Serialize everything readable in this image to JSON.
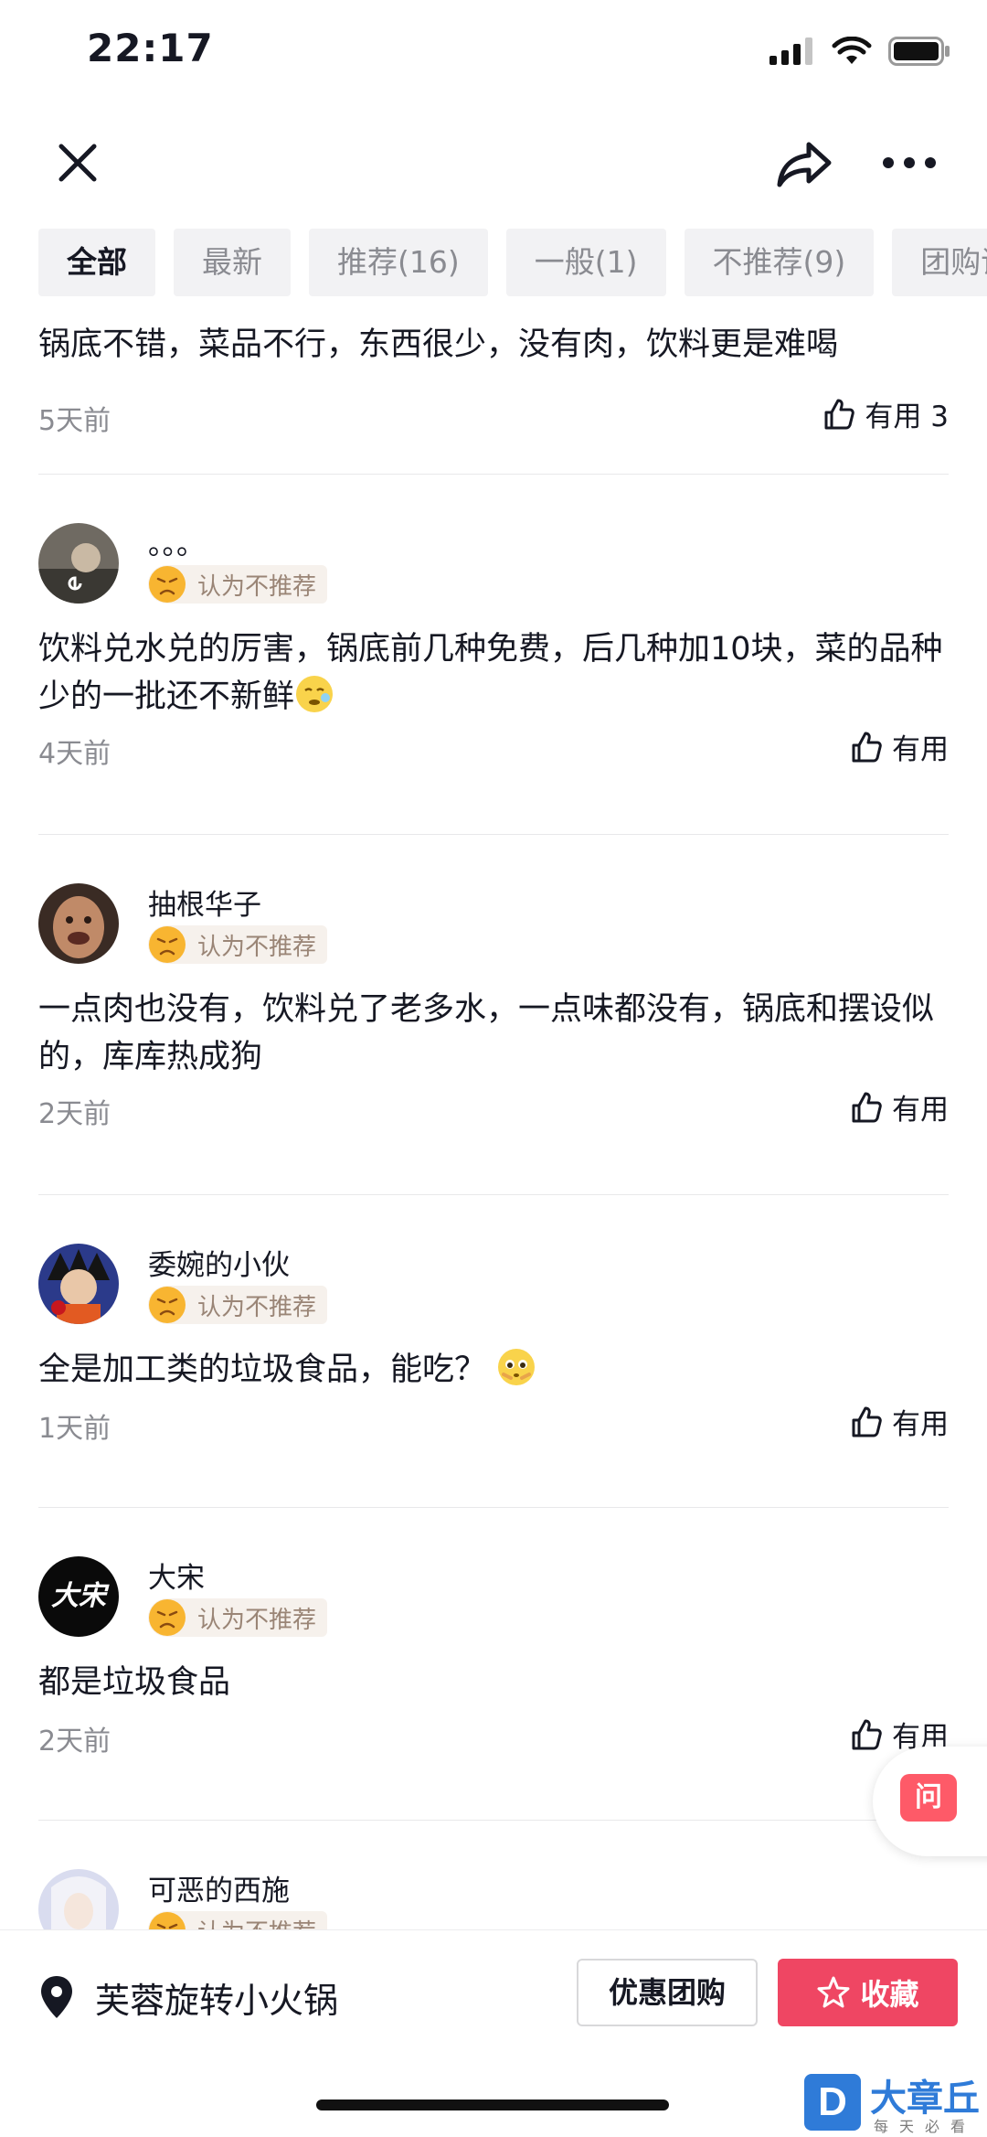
{
  "status_bar": {
    "time": "22:17"
  },
  "filter_tabs": [
    "全部",
    "最新",
    "推荐(16)",
    "一般(1)",
    "不推荐(9)",
    "团购评价"
  ],
  "partial_review": {
    "text": "锅底不错，菜品不行，东西很少，没有肉，饮料更是难喝",
    "time": "5天前",
    "useful_label": "有用 3"
  },
  "reviews": [
    {
      "name": "。。。",
      "rating": "认为不推荐",
      "text": "饮料兑水兑的厉害，锅底前几种免费，后几种加10块，菜的品种少的一批还不新鲜",
      "time": "4天前",
      "useful_label": "有用"
    },
    {
      "name": "抽根华子",
      "rating": "认为不推荐",
      "text": "一点肉也没有，饮料兑了老多水，一点味都没有，锅底和摆设似的，库库热成狗",
      "time": "2天前",
      "useful_label": "有用"
    },
    {
      "name": "委婉的小伙",
      "rating": "认为不推荐",
      "text": "全是加工类的垃圾食品，能吃？",
      "time": "1天前",
      "useful_label": "有用"
    },
    {
      "name": "大宋",
      "rating": "认为不推荐",
      "text": "都是垃圾食品",
      "time": "2天前",
      "useful_label": "有用",
      "avatar_text": "大宋"
    },
    {
      "name": "可恶的西施",
      "rating": "认为不推荐"
    }
  ],
  "ask_float": {
    "label": "问"
  },
  "bottom_bar": {
    "poi_name": "芙蓉旋转小火锅",
    "group_buy_label": "优惠团购",
    "favorite_label": "收藏"
  },
  "watermark": {
    "title": "大章丘",
    "subtitle": "每天必看"
  },
  "colors": {
    "accent": "#ef4663",
    "rating_bg": "#f6f1ec",
    "muted": "#8a8b91"
  }
}
